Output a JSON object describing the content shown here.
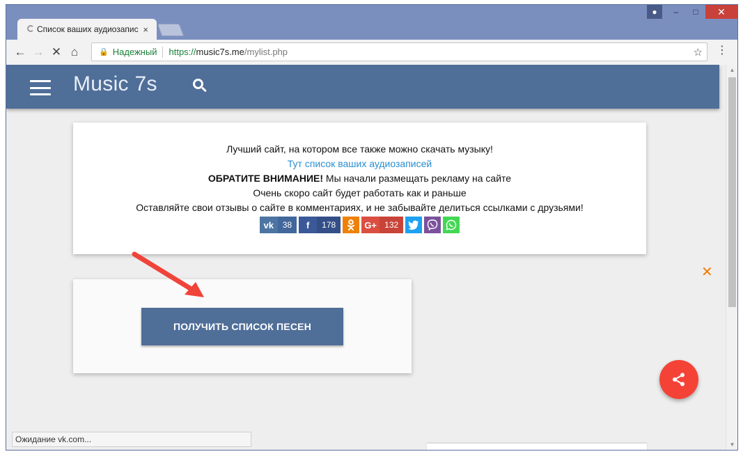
{
  "browser": {
    "tab_title": "Список ваших аудиозаписей",
    "tab_close": "×",
    "nav_back": "←",
    "nav_forward": "→",
    "nav_stop": "✕",
    "nav_home": "⌂",
    "security_label": "Надежный",
    "url_scheme": "https://",
    "url_host": "music7s.me",
    "url_path": "/mylist.php",
    "bookmark_icon": "☆",
    "menu_icon": "⋮",
    "status_text": "Ожидание vk.com..."
  },
  "site": {
    "title": "Music 7s",
    "info_lines": {
      "line1": "Лучший сайт, на котором все также можно скачать музыку!",
      "link": "Тут список ваших аудиозаписей",
      "notice_bold": "ОБРАТИТЕ ВНИМАНИЕ!",
      "notice_rest": " Мы начали размещать рекламу на сайте",
      "line3": "Очень скоро сайт будет работать как и раньше",
      "line4": "Оставляйте свои отзывы о сайте в комментариях, и не забывайте делиться ссылками с друзьями!"
    },
    "shares": {
      "vk_icon": "vk",
      "vk_count": "38",
      "fb_icon": "f",
      "fb_count": "178",
      "ok_icon": "ok",
      "gp_icon": "G+",
      "gp_count": "132"
    },
    "get_list_button": "ПОЛУЧИТЬ СПИСОК ПЕСЕН",
    "close_x": "✕"
  },
  "colors": {
    "header": "#4f6e98",
    "fab": "#f44336",
    "link": "#2a8ed0",
    "arrow": "#f0433a"
  }
}
